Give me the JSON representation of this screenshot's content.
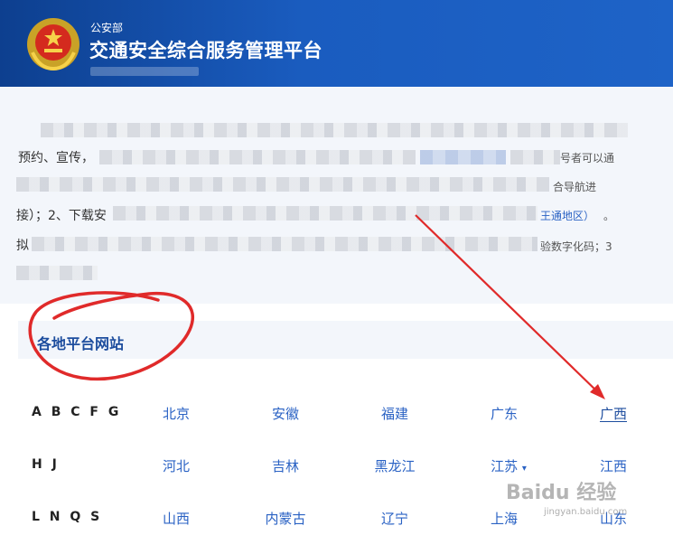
{
  "header": {
    "ministry": "公安部",
    "title": "交通安全综合服务管理平台",
    "emblem": "police-emblem"
  },
  "notice": {
    "line1_start": "预约、宣传，",
    "line1_end": "号者可以通",
    "line2_end": "合导航进",
    "line3_start": "接）；2、下载安",
    "line3_link": "王通地区）",
    "line3_end": "。",
    "line4_start": "拟",
    "line4_end": "验数字化码；3"
  },
  "section": {
    "title": "各地平台网站"
  },
  "rows": [
    {
      "letters": "A B C F G",
      "provinces": [
        "北京",
        "安徽",
        "福建",
        "广东",
        "广西"
      ]
    },
    {
      "letters": "H J",
      "provinces": [
        "河北",
        "吉林",
        "黑龙江",
        "江苏",
        "江西"
      ]
    },
    {
      "letters": "L N Q S",
      "provinces": [
        "山西",
        "内蒙古",
        "辽宁",
        "上海",
        "山东"
      ]
    }
  ],
  "dropdown_caret": "▾",
  "watermark": {
    "logo": "Baidu 经验",
    "sub": "jingyan.baidu.com"
  },
  "colors": {
    "header_blue": "#1a5cbf",
    "link_blue": "#2a62c4",
    "annotation_red": "#e02a2a"
  }
}
